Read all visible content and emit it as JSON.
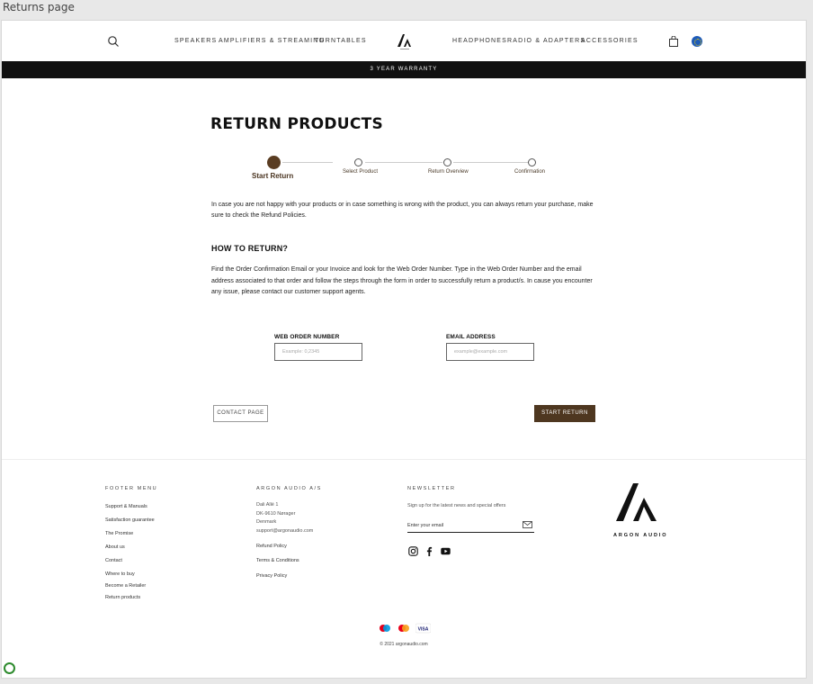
{
  "frame": {
    "title": "Returns page"
  },
  "header": {
    "nav_left": [
      "Speakers",
      "Amplifiers & Streaming",
      "Turntables"
    ],
    "nav_right": [
      "Headphones",
      "Radio & Adapters",
      "Accessories"
    ],
    "logo": "argon-logo-icon",
    "icons": [
      "search-icon",
      "cart-icon",
      "globe-icon"
    ]
  },
  "promo": {
    "text": "3 YEAR WARRANTY"
  },
  "main": {
    "title": "RETURN PRODUCTS",
    "steps": [
      {
        "label": "Start Return",
        "active": true
      },
      {
        "label": "Select Product",
        "active": false
      },
      {
        "label": "Return Overview",
        "active": false
      },
      {
        "label": "Confirmation",
        "active": false
      }
    ],
    "intro": "In case you are not happy with your products or in case something is wrong with the product, you can always return your purchase, make sure to check the Refund Policies.",
    "how_title": "HOW TO RETURN?",
    "how_text": "Find the Order Confirmation Email or your Invoice and look for the Web Order Number. Type in the Web Order Number and the email address associated to that order and follow the steps through the form in order to successfully return a product/s. In cause you encounter any issue, please contact our customer support agents.",
    "order_label": "WEB ORDER NUMBER",
    "order_placeholder": "Example: 0,2345",
    "email_label": "EMAIL ADDRESS",
    "email_placeholder": "example@example.com",
    "contact_button": "CONTACT PAGE",
    "start_button": "START RETURN"
  },
  "footer": {
    "menu_title": "FOOTER MENU",
    "menu": [
      "Support & Manuals",
      "Satisfaction guarantee",
      "The Promise",
      "About us",
      "Contact",
      "Where to buy",
      "Become a Retailer",
      "Return products"
    ],
    "company_title": "ARGON AUDIO A/S",
    "address": [
      "Dali Allé 1",
      "DK-9610 Nørager",
      "Denmark",
      "support@argonaudio.com"
    ],
    "policies": [
      "Refund Policy",
      "Terms & Conditions",
      "Privacy Policy"
    ],
    "newsletter_title": "NEWSLETTER",
    "newsletter_text": "Sign up for the latest news and special offers",
    "newsletter_placeholder": "Enter your email",
    "social": [
      "instagram-icon",
      "facebook-icon",
      "youtube-icon"
    ],
    "brand_name": "ARGON AUDIO",
    "payments": [
      "maestro-icon",
      "mastercard-icon",
      "visa-icon"
    ],
    "visa_text": "VISA",
    "copyright": "© 2021 argonaudio.com"
  }
}
